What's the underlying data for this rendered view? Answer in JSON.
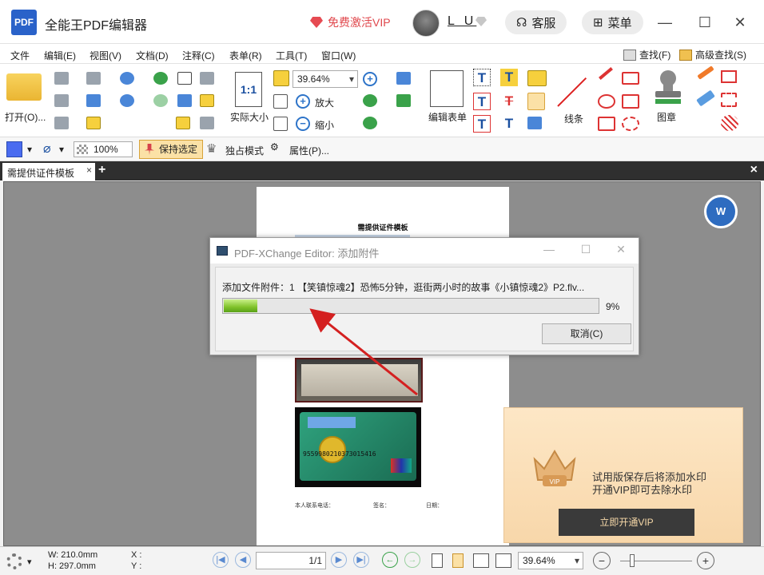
{
  "app": {
    "logo_text": "PDF",
    "title": "全能王PDF编辑器",
    "vip_promo": "免费激活VIP",
    "user_name": "L U",
    "service_label": "客服",
    "menu_label": "菜单"
  },
  "menubar": {
    "items": [
      "文件",
      "编辑(E)",
      "视图(V)",
      "文档(D)",
      "注释(C)",
      "表单(R)",
      "工具(T)",
      "窗口(W)"
    ],
    "find": "查找(F)",
    "advanced_find": "高级查找(S)"
  },
  "ribbon": {
    "open": "打开(O)...",
    "actual_size": "实际大小",
    "zoom_value": "39.64%",
    "zoom_in": "放大",
    "zoom_out": "缩小",
    "edit_form": "编辑表单",
    "lines": "线条",
    "stamp": "图章"
  },
  "propbar": {
    "opacity": "100%",
    "keep_selected": "保持选定",
    "exclusive_mode": "独占模式",
    "properties": "属性(P)..."
  },
  "tabs": {
    "active_doc": "需提供证件模板"
  },
  "document": {
    "title": "需提供证件模板",
    "card_number": "9559980210373015416",
    "footer_phone": "本人联系电话：",
    "footer_sign": "签名：",
    "footer_date": "日期："
  },
  "dialog": {
    "title": "PDF-XChange Editor: 添加附件",
    "message": "添加文件附件：1 【笑镇惊魂2】恐怖5分钟，逛街两小时的故事《小镇惊魂2》P2.flv...",
    "progress": 0.09,
    "progress_text": "9%",
    "cancel": "取消(C)"
  },
  "vip_notice": {
    "line1": "试用版保存后将添加水印",
    "line2": "开通VIP即可去除水印",
    "cta": "立即开通VIP"
  },
  "status": {
    "width": "W: 210.0mm",
    "height": "H: 297.0mm",
    "x_label": "X :",
    "y_label": "Y :",
    "page": "1/1",
    "zoom": "39.64%"
  },
  "colors": {
    "accent_blue": "#2a62c9",
    "promo_red": "#e0474c",
    "arrow_red": "#d42020",
    "progress_green": "#7fc22a"
  }
}
